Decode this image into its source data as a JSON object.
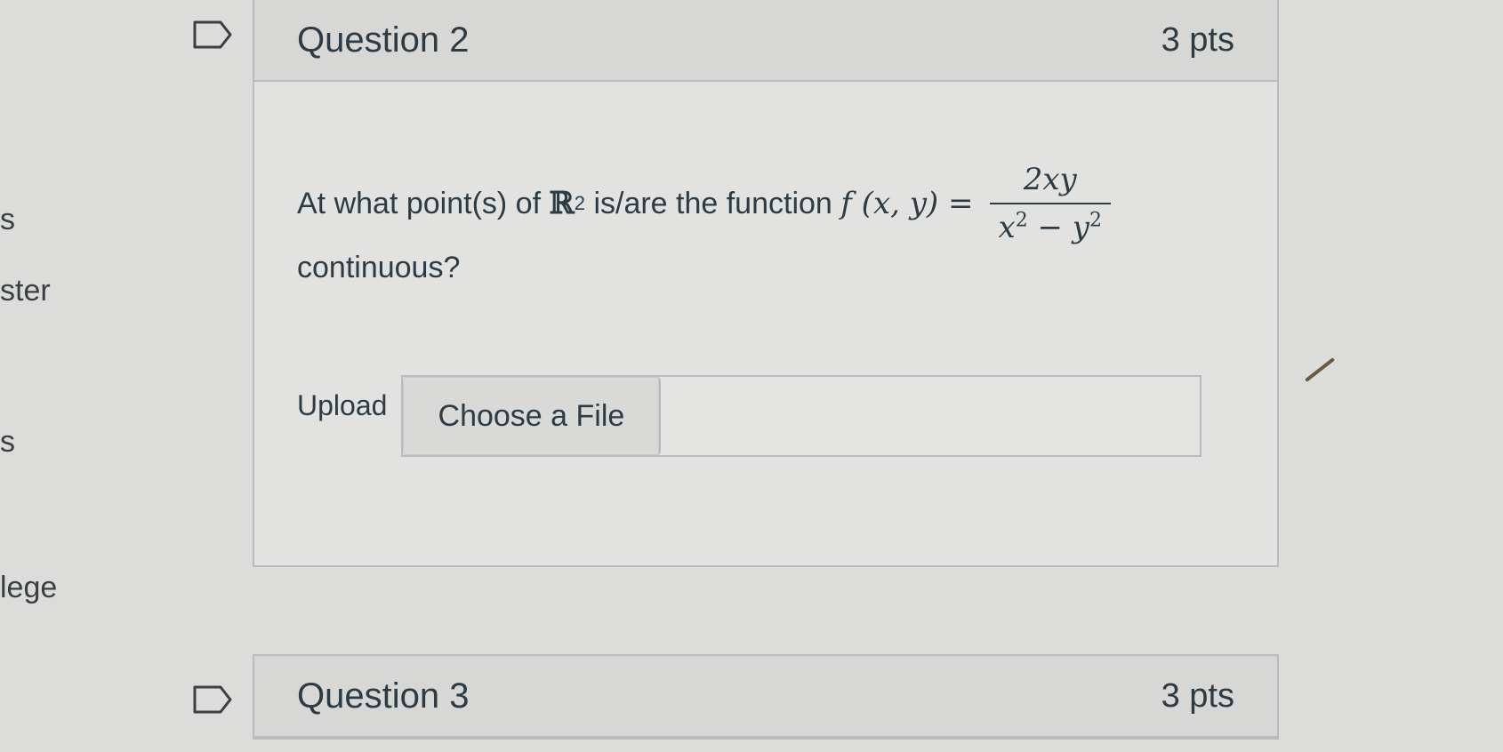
{
  "sidebar": {
    "fragments": [
      "s",
      "ster",
      "s",
      "lege"
    ]
  },
  "question2": {
    "name": "Question 2",
    "points": "3 pts",
    "text_start": "At what point(s) of",
    "set_symbol": "ℝ",
    "set_exponent": "2",
    "text_mid": "is/are the function",
    "func_lhs": "f (x, y) =",
    "numerator": "2xy",
    "den_x": "x",
    "den_x_exp": "2",
    "den_minus": " − ",
    "den_y": "y",
    "den_y_exp": "2",
    "text_end": "continuous?",
    "upload_label": "Upload",
    "choose_file_label": "Choose a File"
  },
  "question3": {
    "name": "Question 3",
    "points": "3 pts"
  },
  "icons": {
    "flag": "flag-icon"
  },
  "colors": {
    "text": "#2d3b45",
    "border": "#b9bbbd",
    "header_bg": "#d7d8d6"
  }
}
